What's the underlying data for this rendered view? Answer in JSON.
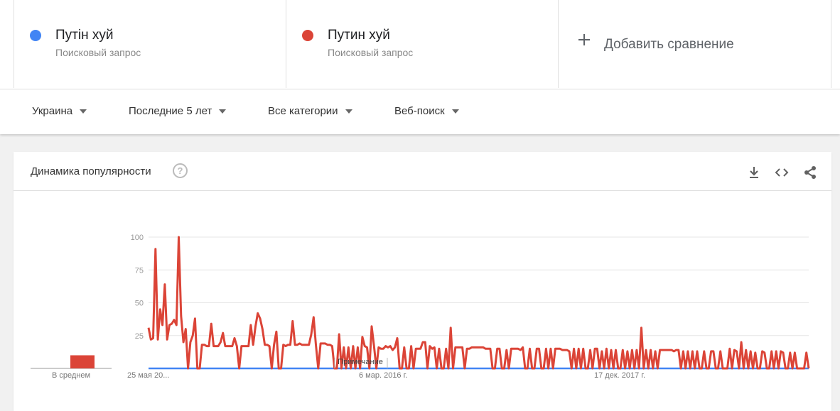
{
  "terms": [
    {
      "name": "Путін хуй",
      "subtitle": "Поисковый запрос",
      "color": "#4285f4"
    },
    {
      "name": "Путин хуй",
      "subtitle": "Поисковый запрос",
      "color": "#db4437"
    }
  ],
  "add_compare": {
    "label": "Добавить сравнение"
  },
  "filters": {
    "region": "Украина",
    "period": "Последние 5 лет",
    "category": "Все категории",
    "search_type": "Веб-поиск"
  },
  "card": {
    "title": "Динамика популярности",
    "help_icon": "help-circle-icon",
    "tools": [
      "download-icon",
      "embed-code-icon",
      "share-icon"
    ]
  },
  "chart_data": {
    "type": "line",
    "average_label": "В среднем",
    "averages": [
      0,
      10
    ],
    "x_tick_labels": [
      "25 мая 20...",
      "6 мар. 2016 г.",
      "17 дек. 2017 г."
    ],
    "y_ticks": [
      25,
      50,
      75,
      100
    ],
    "ylim": [
      0,
      100
    ],
    "note_label": "Примечание",
    "grid": true,
    "series": [
      {
        "name": "Путін хуй",
        "color": "#4285f4",
        "values": [
          0,
          0,
          0,
          0,
          0,
          0,
          0,
          0,
          0,
          0,
          0,
          0,
          0,
          0,
          0,
          0,
          0,
          0,
          0,
          0,
          0,
          0,
          0,
          0,
          0,
          0,
          0,
          0,
          0,
          0,
          0,
          0,
          0,
          0,
          0,
          0,
          0,
          0,
          0,
          0,
          0,
          0,
          0,
          0,
          0,
          0,
          0,
          0,
          0,
          0,
          0,
          0,
          0,
          0,
          0,
          0,
          0,
          0,
          0,
          0,
          0,
          0,
          0,
          0,
          0,
          0,
          0,
          0,
          0,
          0,
          0,
          0,
          0,
          0,
          0,
          0,
          0,
          0,
          0,
          0,
          0,
          0,
          0,
          0,
          0,
          0,
          0,
          0,
          0,
          0,
          0,
          0,
          0,
          0,
          0,
          0,
          0,
          0,
          0,
          0,
          0,
          0,
          0,
          0,
          0,
          0,
          0,
          0,
          0,
          0,
          0,
          0,
          0,
          0,
          0,
          0,
          0,
          0,
          0,
          0,
          0,
          0,
          0,
          0,
          0,
          0,
          0,
          0,
          0,
          0,
          0,
          0,
          0,
          0,
          0,
          0,
          0,
          0,
          0,
          0,
          0,
          0,
          0,
          0,
          0,
          0,
          0,
          0,
          0,
          0,
          0,
          0,
          0,
          0,
          0,
          0,
          0,
          0,
          0,
          0,
          0,
          0,
          0,
          0,
          0,
          0,
          0,
          0,
          0,
          0,
          0,
          0,
          0,
          0,
          0,
          0,
          0,
          0,
          0,
          0,
          0,
          0,
          0,
          0,
          0,
          0,
          0,
          0,
          0,
          0,
          0,
          0,
          0,
          0,
          0,
          0,
          0,
          0,
          0,
          0,
          0,
          0,
          0,
          0,
          0,
          0,
          0,
          0,
          0,
          0,
          0,
          0,
          0,
          0,
          0,
          0,
          0,
          0,
          0,
          0,
          0,
          0,
          0,
          0,
          0,
          0,
          0,
          0,
          0,
          0,
          0,
          0,
          0,
          0,
          0,
          0,
          0,
          0,
          0,
          0,
          0,
          0,
          0,
          0,
          0,
          0,
          0,
          0,
          0,
          0,
          0,
          0,
          0,
          0,
          0,
          0,
          0,
          0,
          0,
          0,
          0,
          0
        ]
      },
      {
        "name": "Путин хуй",
        "color": "#db4437",
        "values": [
          31,
          22,
          23,
          91,
          22,
          45,
          33,
          64,
          22,
          33,
          34,
          37,
          33,
          100,
          40,
          20,
          30,
          0,
          20,
          25,
          38,
          0,
          0,
          18,
          18,
          17,
          17,
          34,
          17,
          17,
          17,
          20,
          27,
          17,
          17,
          17,
          17,
          23,
          17,
          0,
          17,
          17,
          17,
          17,
          33,
          18,
          32,
          42,
          38,
          30,
          18,
          18,
          17,
          0,
          18,
          28,
          0,
          0,
          18,
          17,
          18,
          18,
          36,
          18,
          18,
          19,
          18,
          18,
          18,
          18,
          26,
          39,
          18,
          0,
          19,
          19,
          19,
          18,
          18,
          17,
          0,
          0,
          26,
          0,
          16,
          0,
          16,
          0,
          17,
          0,
          16,
          0,
          24,
          17,
          16,
          0,
          32,
          17,
          0,
          16,
          15,
          15,
          17,
          16,
          17,
          14,
          16,
          23,
          0,
          0,
          16,
          0,
          0,
          17,
          0,
          15,
          15,
          15,
          20,
          20,
          0,
          17,
          15,
          16,
          0,
          15,
          0,
          0,
          15,
          0,
          31,
          0,
          16,
          16,
          16,
          16,
          0,
          15,
          15,
          16,
          16,
          16,
          16,
          16,
          16,
          15,
          15,
          15,
          0,
          0,
          15,
          15,
          0,
          0,
          14,
          0,
          15,
          15,
          15,
          15,
          14,
          16,
          0,
          0,
          15,
          0,
          0,
          15,
          15,
          0,
          0,
          15,
          0,
          15,
          0,
          15,
          15,
          15,
          14,
          14,
          14,
          13,
          0,
          15,
          0,
          15,
          0,
          15,
          0,
          0,
          14,
          0,
          15,
          15,
          0,
          13,
          0,
          15,
          0,
          14,
          0,
          14,
          0,
          0,
          14,
          0,
          13,
          0,
          14,
          0,
          14,
          0,
          31,
          0,
          14,
          0,
          14,
          0,
          13,
          0,
          14,
          14,
          14,
          14,
          14,
          14,
          13,
          14,
          14,
          0,
          13,
          0,
          13,
          0,
          13,
          0,
          13,
          0,
          0,
          13,
          0,
          0,
          13,
          13,
          0,
          0,
          13,
          0,
          0,
          0,
          15,
          0,
          14,
          13,
          0,
          20,
          0,
          14,
          0,
          13,
          0,
          12,
          0,
          0,
          13,
          12,
          0,
          0,
          13,
          0,
          13,
          0,
          13,
          12,
          0,
          0,
          12,
          0,
          12,
          0,
          0,
          0,
          0,
          12,
          0
        ]
      }
    ]
  }
}
